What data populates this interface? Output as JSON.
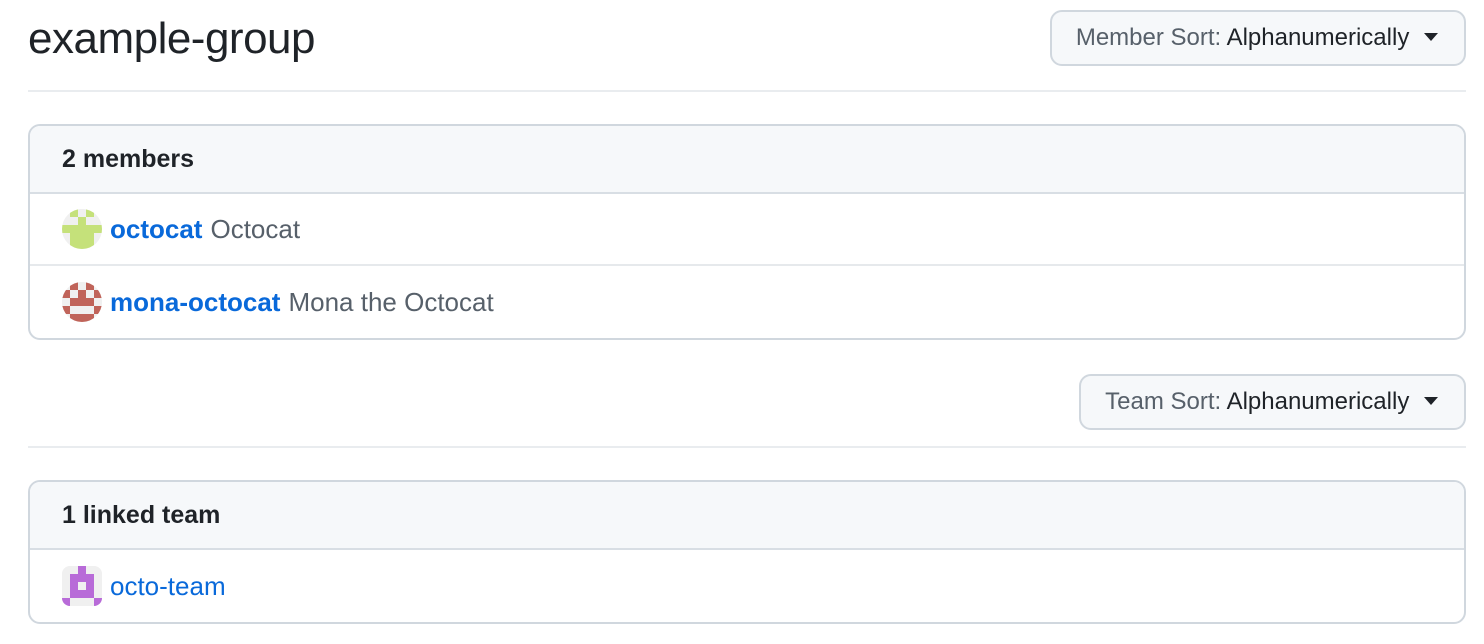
{
  "group": {
    "name": "example-group"
  },
  "member_sort": {
    "prefix": "Member Sort:",
    "value": "Alphanumerically"
  },
  "members_box": {
    "header": "2 members",
    "members": [
      {
        "login": "octocat",
        "name": "Octocat",
        "avatar_color": "#c5e17a"
      },
      {
        "login": "mona-octocat",
        "name": "Mona the Octocat",
        "avatar_color": "#c0645a"
      }
    ]
  },
  "team_sort": {
    "prefix": "Team Sort:",
    "value": "Alphanumerically"
  },
  "teams_box": {
    "header": "1 linked team",
    "teams": [
      {
        "name": "octo-team",
        "avatar_color": "#b86bd8"
      }
    ]
  },
  "colors": {
    "link": "#0969da",
    "muted": "#57606a",
    "border": "#d0d7de",
    "header_bg": "#f6f8fa"
  }
}
